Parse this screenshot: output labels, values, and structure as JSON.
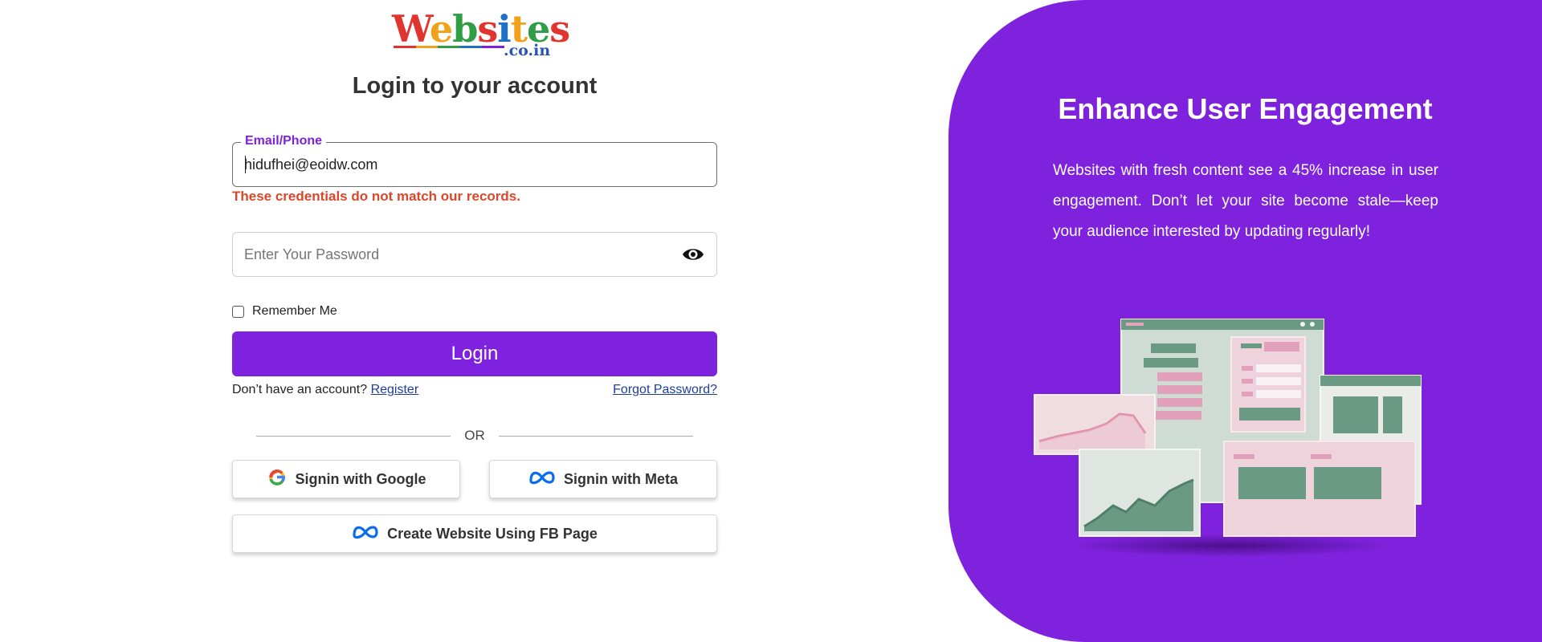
{
  "logo": {
    "word": "Websites",
    "letter_colors": [
      "#e0342f",
      "#f2a21a",
      "#2f9e47",
      "#e0342f",
      "#1d6fc8",
      "#f2a21a",
      "#2f9e47",
      "#e0342f"
    ],
    "suffix": ".co.in"
  },
  "login": {
    "title": "Login to your account",
    "email_label": "Email/Phone",
    "email_value": "hidufhei@eoidw.com",
    "error_message": "These credentials do not match our records.",
    "password_placeholder": "Enter Your Password",
    "eye_icon": "eye-icon",
    "remember_label": "Remember Me",
    "login_button": "Login",
    "no_account_text": "Don’t have an account?",
    "register_link": "Register",
    "forgot_link": "Forgot Password?",
    "or_text": "OR",
    "google_button": "Signin with Google",
    "meta_button": "Signin with Meta",
    "fb_button": "Create Website Using FB Page"
  },
  "panel": {
    "title": "Enhance User Engagement",
    "description": "Websites with fresh content see a 45% increase in user engagement. Don’t let your site become stale—keep your audience interested by updating regularly!",
    "background_color": "#7f22de"
  },
  "colors": {
    "accent": "#7f22e0",
    "error": "#d9482b",
    "link": "#1e3d9b"
  }
}
